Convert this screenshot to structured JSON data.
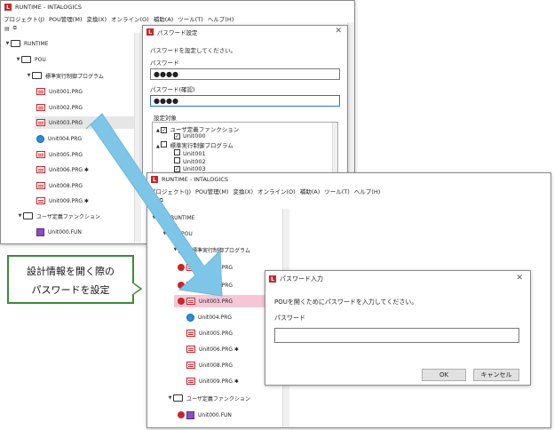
{
  "app": {
    "title": "RUNTIME - INTALOGICS",
    "menu": [
      "プロジェクト(J)",
      "POU管理(M)",
      "変換(X)",
      "オンライン(O)",
      "補助(A)",
      "ツール(T)",
      "ヘルプ(H)"
    ]
  },
  "back_window": {
    "tree": {
      "root": "RUNTIME",
      "pou": "POU",
      "group": "標準実行制御プログラム",
      "items": [
        "Unit001.PRG",
        "Unit002.PRG",
        "Unit003.PRG",
        "Unit004.PRG",
        "Unit005.PRG",
        "Unit006.PRG ✱",
        "Unit008.PRG",
        "Unit009.PRG ✱"
      ],
      "user_group": "ユーザ定義ファンクション",
      "user_item": "Unit000.FUN"
    }
  },
  "password_setup_dialog": {
    "title": "パスワード設定",
    "instruction": "パスワードを設定してください。",
    "password_label": "パスワード",
    "password_value": "●●●●",
    "confirm_label": "パスワード(確認)",
    "confirm_value": "●●●●",
    "target_label": "設定対象",
    "targets": [
      {
        "label": "ユーザ定義ファンクション",
        "checked": true
      },
      {
        "label": "Unit000",
        "checked": true
      },
      {
        "label": "標準実行制御プログラム",
        "checked": false
      },
      {
        "label": "Unit001",
        "checked": false
      },
      {
        "label": "Unit002",
        "checked": false
      },
      {
        "label": "Unit003",
        "checked": true
      }
    ]
  },
  "front_window": {
    "tree": {
      "root": "RUNTIME",
      "pou": "POU",
      "group": "標準実行制御プログラム",
      "items": [
        "Unit001.PRG",
        "Unit002.PRG",
        "Unit003.PRG",
        "Unit004.PRG",
        "Unit005.PRG",
        "Unit006.PRG ✱",
        "Unit008.PRG",
        "Unit009.PRG ✱"
      ],
      "user_group": "ユーザ定義ファンクション",
      "user_item": "Unit000.FUN"
    }
  },
  "password_input_dialog": {
    "title": "パスワード入力",
    "message": "POUを開くためにパスワードを入力してください。",
    "password_label": "パスワード",
    "ok": "OK",
    "cancel": "キャンセル"
  },
  "callout": {
    "line1": "設計情報を開く際の",
    "line2": "パスワードを設定"
  },
  "colors": {
    "accent": "#c8252b",
    "arrow": "#7ec6e8",
    "selection": "#f6c6d6",
    "callout_border": "#3a8a3a"
  }
}
